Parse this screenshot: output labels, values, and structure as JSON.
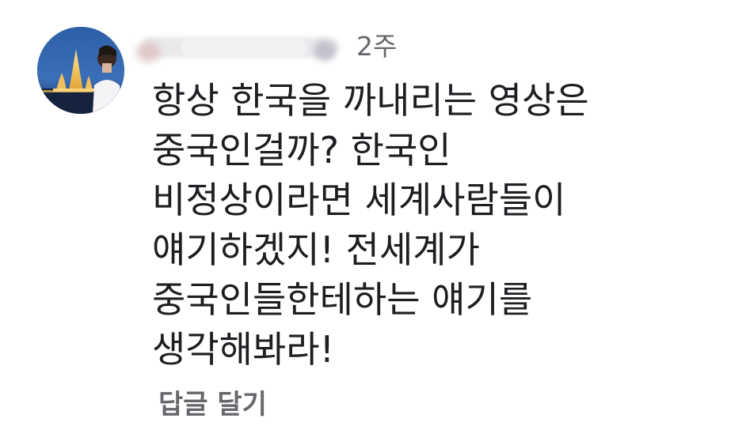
{
  "comment": {
    "author": {
      "avatar_description": "avatar"
    },
    "timestamp": "2주",
    "lines": [
      "항상 한국을 까내리는 영상은",
      "중국인걸까? 한국인",
      "비정상이라면 세계사람들이",
      "얘기하겠지! 전세계가",
      "중국인들한테하는 얘기를",
      "생각해봐라!"
    ],
    "reply_label": "답글 달기"
  },
  "colors": {
    "text": "#1c1e21",
    "secondary_text": "#65676b",
    "background": "#ffffff"
  }
}
